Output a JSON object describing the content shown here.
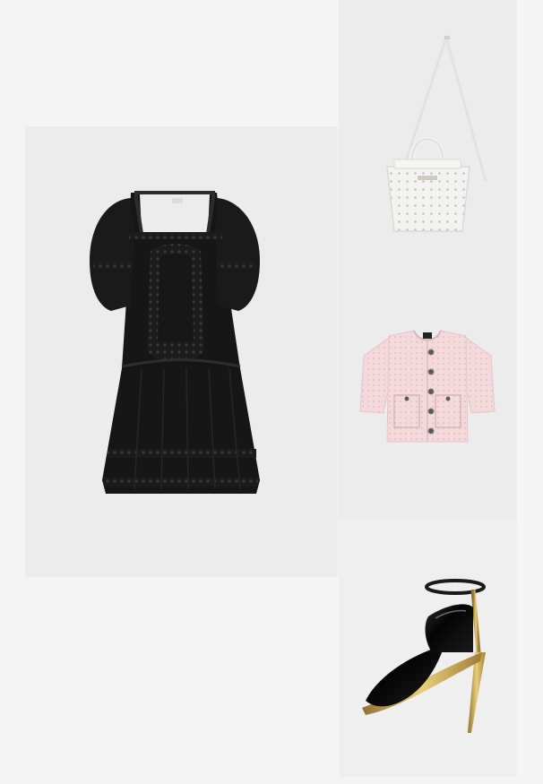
{
  "outfit": {
    "items": [
      {
        "id": "dress",
        "icon": "black-lace-mini-dress-image"
      },
      {
        "id": "bag",
        "icon": "white-perforated-tote-bag-image"
      },
      {
        "id": "jacket",
        "icon": "pink-cropped-tweed-jacket-image"
      },
      {
        "id": "sandal",
        "icon": "black-gold-heeled-sandal-image"
      }
    ],
    "colors": {
      "background": "#f5f5f5",
      "tile": "#ececec",
      "dress": "#141414",
      "bag": "#f2f2f0",
      "jacket": "#f1d6d8",
      "sandal_leather": "#0d0d0d",
      "sandal_metal": "#c9a544"
    }
  }
}
